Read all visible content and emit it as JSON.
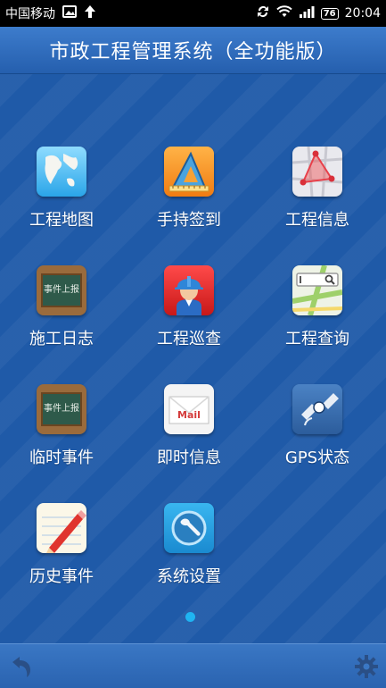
{
  "statusbar": {
    "carrier": "中国移动",
    "battery": "76",
    "time": "20:04",
    "icons": [
      "image-icon",
      "upload-arrow-icon",
      "sync-icon",
      "wifi-icon",
      "signal-icon",
      "battery-icon"
    ]
  },
  "header": {
    "title": "市政工程管理系统（全功能版）"
  },
  "grid": {
    "items": [
      {
        "label": "工程地图",
        "icon": "globe-map-icon"
      },
      {
        "label": "手持签到",
        "icon": "ruler-triangle-icon"
      },
      {
        "label": "工程信息",
        "icon": "map-pin-icon"
      },
      {
        "label": "施工日志",
        "icon": "blackboard-icon"
      },
      {
        "label": "工程巡查",
        "icon": "worker-helmet-icon"
      },
      {
        "label": "工程查询",
        "icon": "search-map-icon"
      },
      {
        "label": "临时事件",
        "icon": "blackboard-icon"
      },
      {
        "label": "即时信息",
        "icon": "mail-icon"
      },
      {
        "label": "GPS状态",
        "icon": "satellite-icon"
      },
      {
        "label": "历史事件",
        "icon": "pencil-note-icon"
      },
      {
        "label": "系统设置",
        "icon": "wrench-settings-icon"
      }
    ],
    "blackboard_text": "事件上报"
  },
  "pager": {
    "current": 1,
    "total": 1
  },
  "bottombar": {
    "icons": [
      "back-icon",
      "gear-icon"
    ]
  },
  "colors": {
    "background": "#1f5aa8",
    "titlebar": "#3d7ccc",
    "page_dot": "#1fb4f2"
  }
}
